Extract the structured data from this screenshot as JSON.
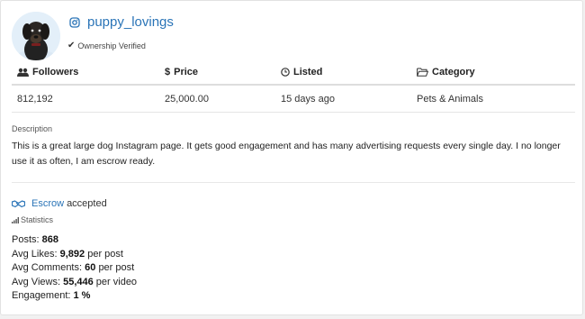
{
  "profile": {
    "handle": "puppy_lovings",
    "verified_text": "Ownership Verified"
  },
  "table": {
    "headers": {
      "followers": "Followers",
      "price": "Price",
      "listed": "Listed",
      "category": "Category"
    },
    "row": {
      "followers": "812,192",
      "price": "25,000.00",
      "listed": "15 days ago",
      "category": "Pets & Animals"
    }
  },
  "description": {
    "label": "Description",
    "text": "This is a great large dog Instagram page. It gets good engagement and has many advertising requests every single day. I no longer use it as often, I am escrow ready."
  },
  "escrow": {
    "link_text": "Escrow",
    "status": "accepted"
  },
  "statistics": {
    "label": "Statistics",
    "posts": {
      "label": "Posts:",
      "value": "868"
    },
    "avg_likes": {
      "label": "Avg Likes:",
      "value": "9,892",
      "suffix": "per post"
    },
    "avg_comments": {
      "label": "Avg Comments:",
      "value": "60",
      "suffix": "per post"
    },
    "avg_views": {
      "label": "Avg Views:",
      "value": "55,446",
      "suffix": "per video"
    },
    "engagement": {
      "label": "Engagement:",
      "value": "1 %"
    }
  },
  "colors": {
    "link": "#2a74b7",
    "border": "#dddddd"
  },
  "icons": {
    "instagram": "instagram-icon",
    "verified": "check-icon",
    "followers": "users-icon",
    "price": "dollar-icon",
    "listed": "clock-icon",
    "category": "folder-open-icon",
    "escrow": "handshake-icon",
    "statistics": "bar-chart-icon"
  }
}
